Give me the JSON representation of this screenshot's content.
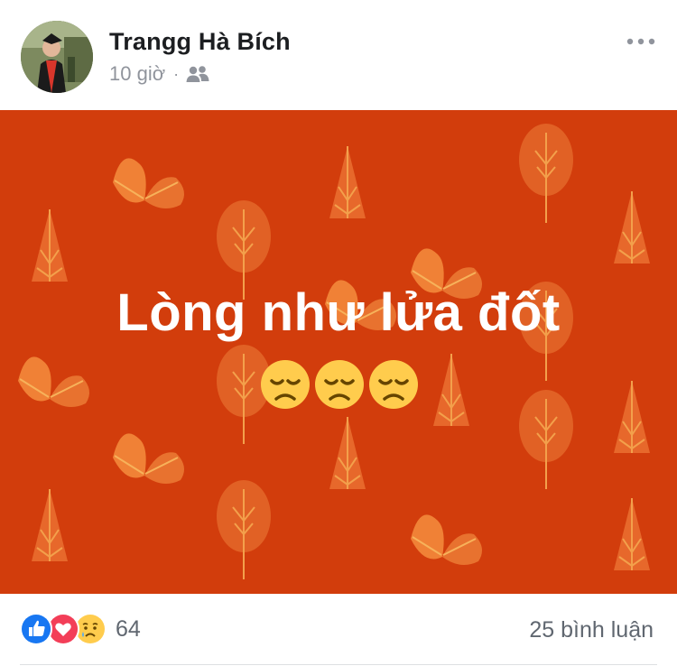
{
  "post": {
    "author": "Trangg Hà Bích",
    "time": "10 giờ",
    "separator": "·",
    "audience_icon": "friends-icon",
    "more_icon": "more-options-icon",
    "background_color": "#d23d0c",
    "text": "Lòng như lửa đốt",
    "emojis": [
      "disappointed-face",
      "disappointed-face",
      "disappointed-face"
    ]
  },
  "reactions": {
    "types": [
      "like",
      "love",
      "sad"
    ],
    "count": "64",
    "comments": "25 bình luận"
  },
  "colors": {
    "accent_like": "#1877f2",
    "accent_love": "#f33e58",
    "emoji_yellow": "#ffcc4d"
  }
}
